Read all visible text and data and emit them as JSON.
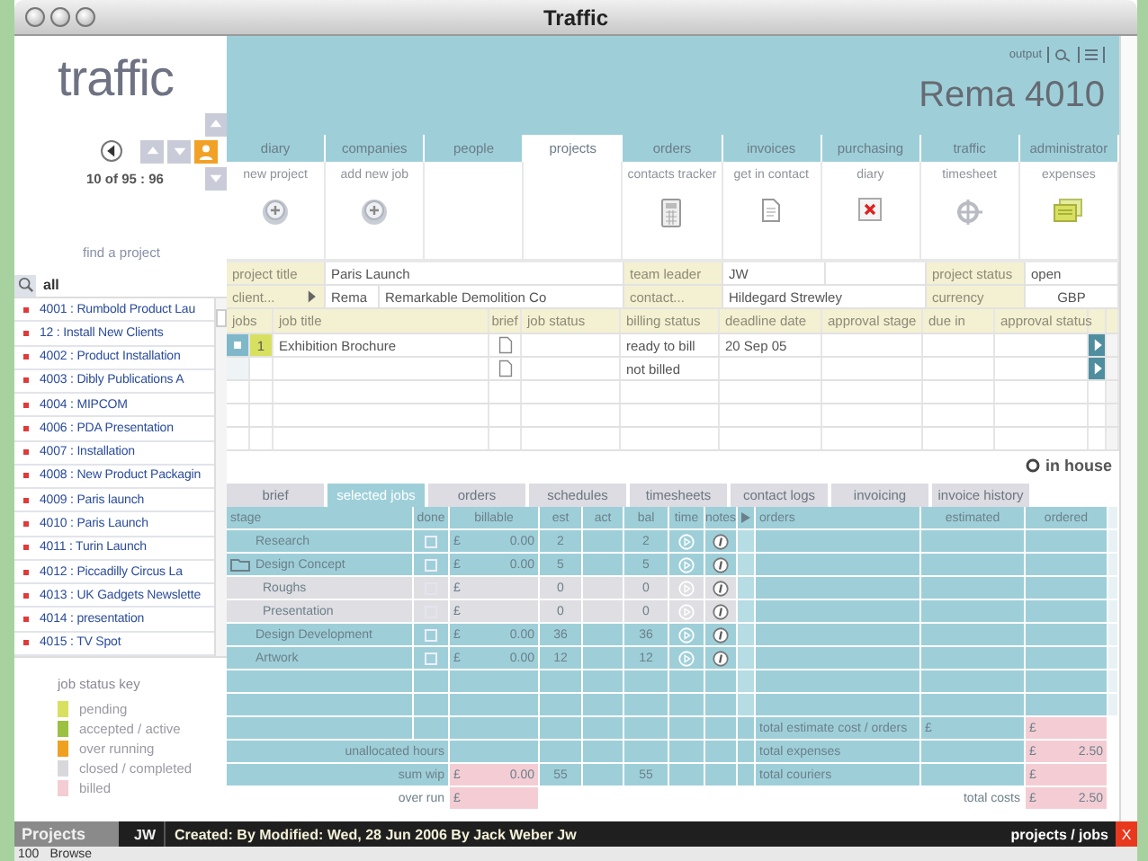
{
  "window": {
    "title": "Traffic"
  },
  "logo": "traffic",
  "header": {
    "output_label": "output",
    "record_title": "Rema 4010"
  },
  "navigator": {
    "counter": "10 of 95 : 96"
  },
  "main_tabs": [
    {
      "label": "diary",
      "selected": false
    },
    {
      "label": "companies",
      "selected": false
    },
    {
      "label": "people",
      "selected": false
    },
    {
      "label": "projects",
      "selected": true
    },
    {
      "label": "orders",
      "selected": false
    },
    {
      "label": "invoices",
      "selected": false
    },
    {
      "label": "purchasing",
      "selected": false
    },
    {
      "label": "traffic",
      "selected": false
    },
    {
      "label": "administrator",
      "selected": false
    }
  ],
  "toolbar": [
    {
      "label": "new project",
      "kind": "add"
    },
    {
      "label": "add new job",
      "kind": "add"
    },
    {
      "kind": "empty"
    },
    {
      "kind": "empty"
    },
    {
      "label": "contacts tracker",
      "kind": "calculator"
    },
    {
      "label": "get in contact",
      "kind": "document"
    },
    {
      "label": "diary",
      "kind": "diary"
    },
    {
      "label": "timesheet",
      "kind": "timer"
    },
    {
      "label": "expenses",
      "kind": "notes"
    }
  ],
  "find_project": {
    "label": "find a project",
    "value": "all"
  },
  "project_list": [
    {
      "label": "4001 : Rumbold Product Lau",
      "color": "#e03a3a"
    },
    {
      "label": "12 : Install New Clients",
      "color": "#e03a3a"
    },
    {
      "label": "4002 : Product Installation",
      "color": "#e03a3a"
    },
    {
      "label": "4003 : Dibly Publications A",
      "color": "#e03a3a"
    },
    {
      "label": "4004 : MIPCOM",
      "color": "#e03a3a"
    },
    {
      "label": "4006 : PDA Presentation",
      "color": "#e03a3a"
    },
    {
      "label": "4007 : Installation",
      "color": "#e03a3a"
    },
    {
      "label": "4008 : New Product Packagin",
      "color": "#e03a3a"
    },
    {
      "label": "4009 : Paris launch",
      "color": "#e03a3a"
    },
    {
      "label": "4010 : Paris Launch",
      "color": "#e03a3a"
    },
    {
      "label": "4011 : Turin Launch",
      "color": "#e03a3a"
    },
    {
      "label": "4012 : Piccadilly Circus La",
      "color": "#e03a3a"
    },
    {
      "label": "4013 : UK Gadgets Newslette",
      "color": "#e03a3a"
    },
    {
      "label": "4014 : presentation",
      "color": "#e03a3a"
    },
    {
      "label": "4015 : TV Spot",
      "color": "#e03a3a"
    }
  ],
  "status_key": {
    "title": "job status key",
    "items": [
      {
        "label": "pending",
        "color": "#d8e060"
      },
      {
        "label": "accepted / active",
        "color": "#9cc040"
      },
      {
        "label": "over running",
        "color": "#f0a020"
      },
      {
        "label": "closed / completed",
        "color": "#d8d8dc"
      },
      {
        "label": "billed",
        "color": "#f4cdd4"
      }
    ]
  },
  "project": {
    "title_label": "project title",
    "title": "Paris Launch",
    "team_leader_label": "team leader",
    "team_leader": "JW",
    "status_label": "project status",
    "status": "open",
    "client_label": "client...",
    "client_code": "Rema",
    "client": "Remarkable Demolition Co",
    "contact_label": "contact...",
    "contact": "Hildegard Strewley",
    "currency_label": "currency",
    "currency": "GBP"
  },
  "jobs": {
    "columns": [
      "jobs",
      "job title",
      "brief",
      "job status",
      "billing status",
      "deadline date",
      "approval stage",
      "due in",
      "approval status"
    ],
    "rows": [
      {
        "selected": true,
        "number": "1",
        "color": "#d8e060",
        "title": "Exhibition Brochure",
        "billing_status": "ready to bill",
        "deadline": "20 Sep 05"
      },
      {
        "selected": false,
        "billing_status": "not billed"
      }
    ]
  },
  "location": {
    "label": "in house"
  },
  "detail_tabs": [
    {
      "label": "brief",
      "selected": false
    },
    {
      "label": "selected jobs",
      "selected": true
    },
    {
      "label": "orders",
      "selected": false
    },
    {
      "label": "schedules",
      "selected": false
    },
    {
      "label": "timesheets",
      "selected": false
    },
    {
      "label": "contact logs",
      "selected": false
    },
    {
      "label": "invoicing",
      "selected": false
    },
    {
      "label": "invoice history",
      "selected": false
    }
  ],
  "stages": {
    "columns": [
      "stage",
      "done",
      "billable",
      "est",
      "act",
      "bal",
      "time",
      "notes"
    ],
    "rows": [
      {
        "name": "Research",
        "done": false,
        "currency": "£",
        "billable": "0.00",
        "est": "2",
        "bal": "2"
      },
      {
        "name": "Design Concept",
        "done": false,
        "currency": "£",
        "billable": "0.00",
        "est": "5",
        "bal": "5",
        "children": [
          {
            "name": "Roughs",
            "done": false,
            "currency": "£",
            "est": "0",
            "bal": "0"
          },
          {
            "name": "Presentation",
            "done": false,
            "currency": "£",
            "est": "0",
            "bal": "0"
          }
        ]
      },
      {
        "name": "Design Development",
        "done": false,
        "currency": "£",
        "billable": "0.00",
        "est": "36",
        "bal": "36"
      },
      {
        "name": "Artwork",
        "done": false,
        "currency": "£",
        "billable": "0.00",
        "est": "12",
        "bal": "12"
      }
    ],
    "summary": {
      "unallocated_label": "unallocated hours",
      "sum_wip_label": "sum wip",
      "sum_wip_currency": "£",
      "sum_wip": "0.00",
      "sum_est": "55",
      "sum_bal": "55",
      "over_run_label": "over run",
      "over_run_currency": "£"
    }
  },
  "orders": {
    "columns": [
      "orders",
      "estimated",
      "ordered"
    ],
    "totals": [
      {
        "kind": "subtotal",
        "label": "total estimate cost / orders",
        "estimated": "£",
        "ordered_currency": "£"
      },
      {
        "kind": "subtotal",
        "label": "total expenses",
        "ordered_currency": "£",
        "ordered": "2.50"
      },
      {
        "kind": "subtotal",
        "label": "total couriers",
        "ordered_currency": "£"
      },
      {
        "kind": "grand",
        "label": "total costs",
        "ordered_currency": "£",
        "ordered": "2.50"
      }
    ]
  },
  "status_bar": {
    "module": "Projects",
    "user": "JW",
    "info": "Created: By Modified: Wed, 28 Jun 2006 By Jack Weber Jw",
    "breadcrumb": "projects / jobs",
    "close": "X"
  },
  "bottom_strip": {
    "zoom": "100",
    "mode": "Browse"
  }
}
